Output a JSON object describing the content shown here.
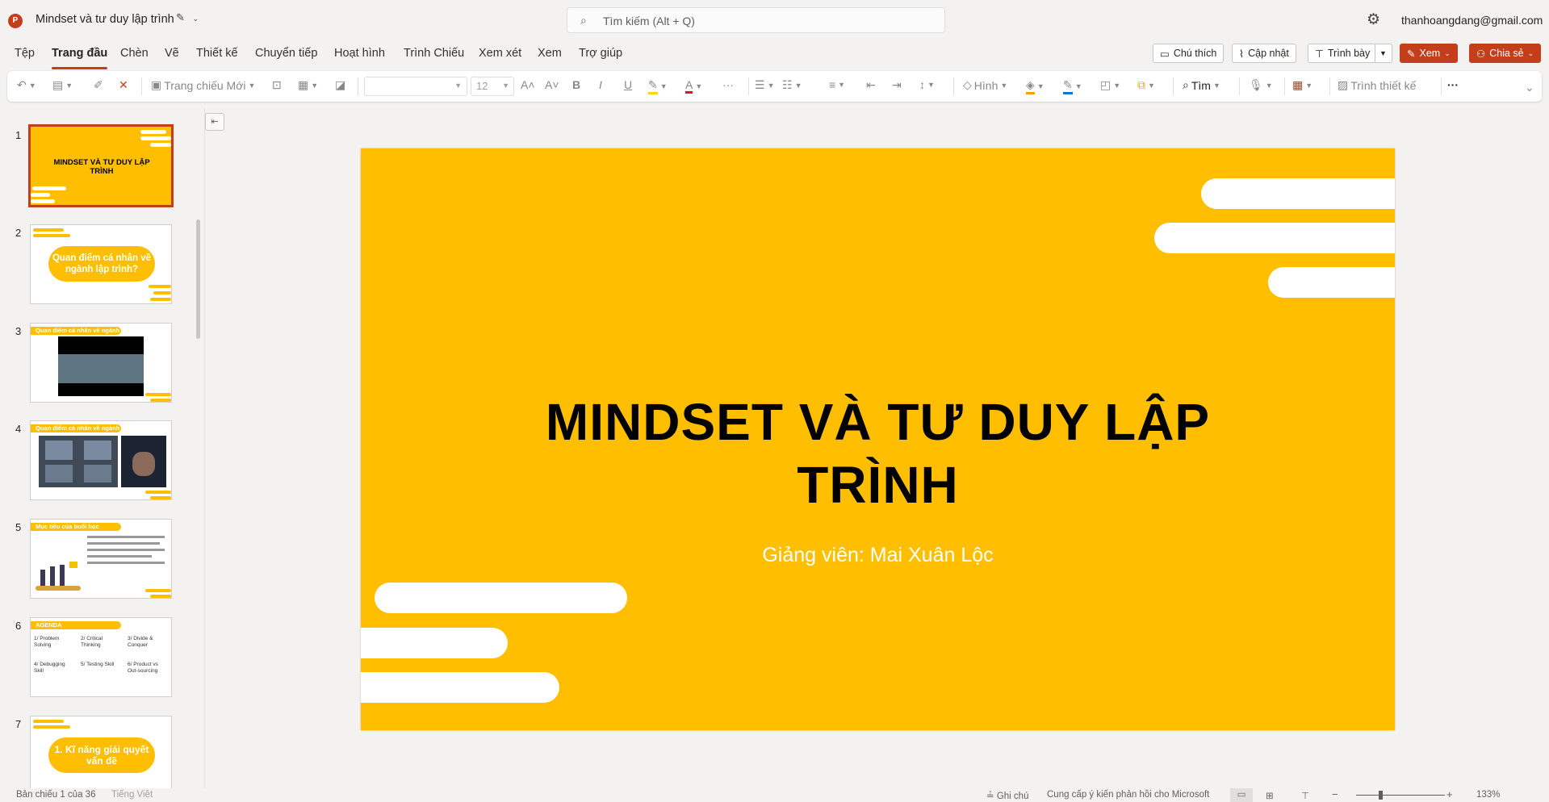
{
  "app": {
    "title": "Mindset và tư duy lập trình",
    "logo_letter": "P",
    "account": "thanhoangdang@gmail.com"
  },
  "search": {
    "placeholder": "Tìm kiếm (Alt + Q)"
  },
  "menu": {
    "tabs": [
      "Tệp",
      "Trang đầu",
      "Chèn",
      "Vẽ",
      "Thiết kế",
      "Chuyển tiếp",
      "Hoạt hình",
      "Trình Chiếu",
      "Xem xét",
      "Xem",
      "Trợ giúp"
    ],
    "active": "Trang đầu"
  },
  "actions": {
    "comments": "Chú thích",
    "catch_up": "Cập nhật",
    "present": "Trình bày",
    "view": "Xem",
    "share": "Chia sẻ"
  },
  "ribbon": {
    "new_slide": "Trang chiếu Mới",
    "font_size": "12",
    "shapes": "Hình",
    "find": "Tìm",
    "designer": "Trình thiết kế"
  },
  "thumbnails": [
    {
      "num": "1",
      "title": "MINDSET VÀ TƯ DUY LẬP TRÌNH"
    },
    {
      "num": "2",
      "title": "Quan điểm cá nhân về ngành lập trình?"
    },
    {
      "num": "3",
      "title": "Quan điểm cá nhân về ngành"
    },
    {
      "num": "4",
      "title": "Quan điểm cá nhân về ngành"
    },
    {
      "num": "5",
      "title": "Mục tiêu của buổi học"
    },
    {
      "num": "6",
      "title": "AGENDA",
      "items": [
        "1/ Problem Solving",
        "2/ Critical Thinking",
        "3/ Divide & Conquer",
        "4/ Debugging Skill",
        "5/ Testing Skill",
        "6/ Product vs Out-sourcing"
      ]
    },
    {
      "num": "7",
      "title": "1. Kĩ năng giải quyết vấn đề"
    }
  ],
  "slide": {
    "title_line1": "MINDSET VÀ TƯ DUY LẬP",
    "title_line2": "TRÌNH",
    "subtitle": "Giảng viên: Mai Xuân Lộc"
  },
  "status": {
    "slide_info": "Bản chiếu 1 của 36",
    "language": "Tiếng Việt",
    "notes": "Ghi chú",
    "feedback": "Cung cấp ý kiến phản hồi cho Microsoft",
    "zoom": "133%"
  },
  "colors": {
    "accent": "#c43e1c",
    "slide_bg": "#ffbf00"
  }
}
